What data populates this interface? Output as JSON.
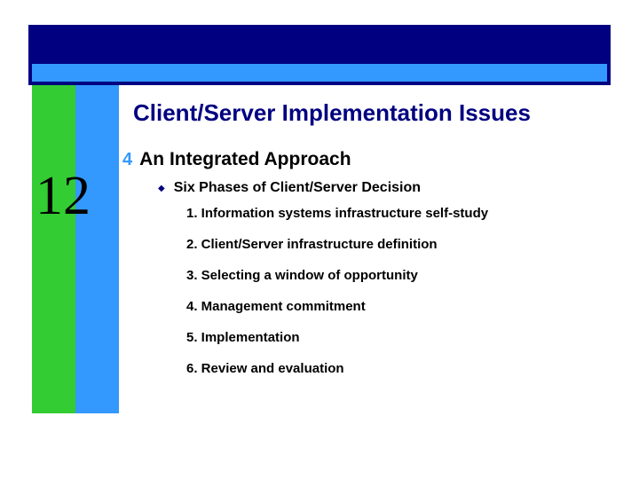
{
  "title": "Client/Server Implementation Issues",
  "bullet": "An Integrated Approach",
  "subheading": "Six Phases of Client/Server Decision",
  "chapter": "12",
  "phases": {
    "p1": "1. Information systems infrastructure self-study",
    "p2": "2. Client/Server infrastructure definition",
    "p3": "3. Selecting a window of opportunity",
    "p4": "4. Management commitment",
    "p5": "5. Implementation",
    "p6": "6. Review and evaluation"
  }
}
